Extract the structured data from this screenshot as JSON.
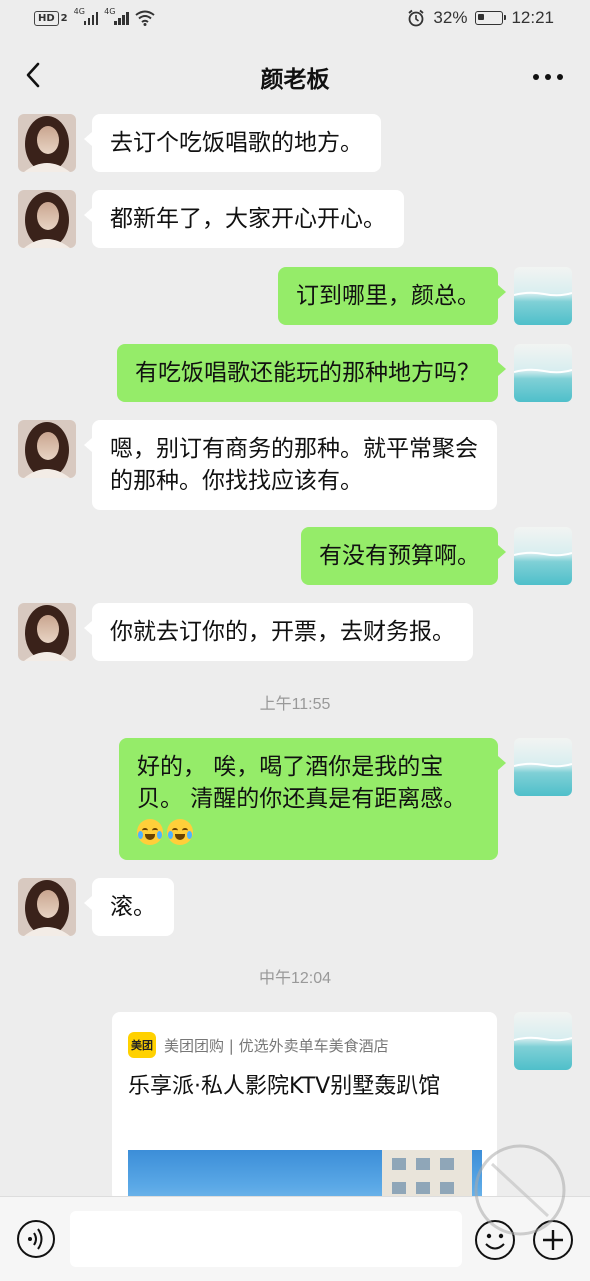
{
  "status_bar": {
    "hd_label": "HD",
    "sim_label": "2",
    "net1": "4G",
    "net2": "4G",
    "battery": "32%",
    "battery_level": 0.32,
    "time": "12:21"
  },
  "header": {
    "title": "颜老板",
    "back_icon": "chevron-left-icon",
    "more_icon": "more-dots-icon"
  },
  "messages": [
    {
      "side": "in",
      "text": "去订个吃饭唱歌的地方。"
    },
    {
      "side": "in",
      "text": "都新年了，大家开心开心。"
    },
    {
      "side": "out",
      "text": "订到哪里，颜总。"
    },
    {
      "side": "out",
      "text": "有吃饭唱歌还能玩的那种地方吗？"
    },
    {
      "side": "in",
      "text": "嗯，别订有商务的那种。就平常聚会的那种。你找找应该有。"
    },
    {
      "side": "out",
      "text": "有没有预算啊。"
    },
    {
      "side": "in",
      "text": "你就去订你的，开票，去财务报。"
    },
    {
      "side": "out",
      "text": "好的， 唉，喝了酒你是我的宝贝。 清醒的你还真是有距离感。",
      "emoji": [
        "sob-laugh-emoji",
        "sob-laugh-emoji"
      ]
    },
    {
      "side": "in",
      "text": "滚。"
    }
  ],
  "timestamps": {
    "t1": "上午11:55",
    "t2": "中午12:04"
  },
  "card": {
    "logo_text": "美团",
    "source": "美团团购 | 优选外卖单车美食酒店",
    "title": "乐享派·私人影院KTV别墅轰趴馆"
  },
  "input_bar": {
    "voice_icon": "voice-icon",
    "emoji_icon": "smiley-icon",
    "plus_icon": "plus-icon",
    "input_value": ""
  },
  "colors": {
    "background": "#ededed",
    "outgoing_bubble": "#95ec69",
    "incoming_bubble": "#ffffff",
    "meituan_yellow": "#ffd100"
  }
}
